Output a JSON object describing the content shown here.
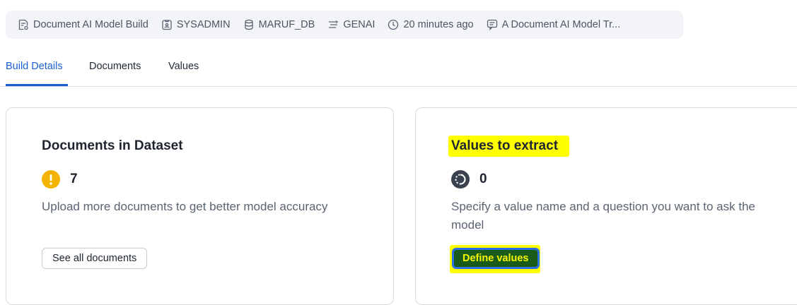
{
  "meta_bar": {
    "items": [
      {
        "icon": "document-gear-icon",
        "label": "Document AI Model Build"
      },
      {
        "icon": "user-badge-icon",
        "label": "SYSADMIN"
      },
      {
        "icon": "database-icon",
        "label": "MARUF_DB"
      },
      {
        "icon": "schema-icon",
        "label": "GENAI"
      },
      {
        "icon": "clock-icon",
        "label": "20 minutes ago"
      },
      {
        "icon": "comment-icon",
        "label": "A Document AI Model Tr..."
      }
    ]
  },
  "tabs": [
    {
      "label": "Build Details",
      "active": true
    },
    {
      "label": "Documents",
      "active": false
    },
    {
      "label": "Values",
      "active": false
    }
  ],
  "cards": {
    "documents": {
      "title": "Documents in Dataset",
      "status_icon": "warning-icon",
      "status_color": "#f2b400",
      "count": "7",
      "description": "Upload more documents to get better model accuracy",
      "button_label": "See all documents"
    },
    "values": {
      "title": "Values to extract",
      "status_icon": "progress-circle-icon",
      "status_color": "#3a4250",
      "count": "0",
      "description": "Specify a value name and a question you want to ask the model",
      "button_label": "Define values"
    }
  },
  "colors": {
    "accent": "#1a5fd1",
    "highlight": "#ffff00"
  }
}
